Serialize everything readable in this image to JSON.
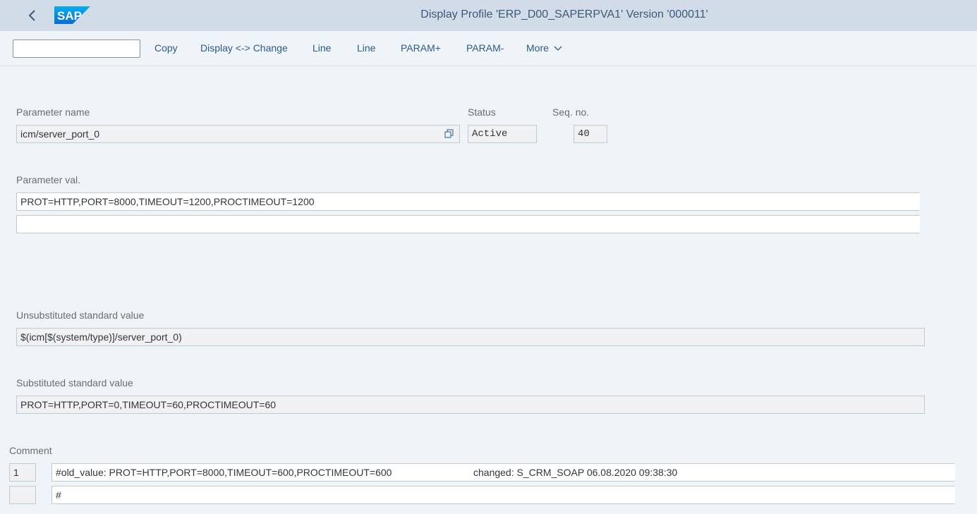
{
  "shell": {
    "logo_text": "SAP",
    "title": "Display Profile 'ERP_D00_SAPERPVA1' Version '000011'"
  },
  "toolbar": {
    "command_field_value": "",
    "buttons": [
      "Copy",
      "Display <-> Change",
      "Line",
      "Line",
      "PARAM+",
      "PARAM-",
      "More"
    ]
  },
  "form": {
    "param_name_label": "Parameter name",
    "param_name_value": "icm/server_port_0",
    "status_label": "Status",
    "status_value": "Active",
    "seq_label": "Seq. no.",
    "seq_value": "40",
    "param_val_label": "Parameter val.",
    "param_val_line1": "PROT=HTTP,PORT=8000,TIMEOUT=1200,PROCTIMEOUT=1200",
    "param_val_line2": "",
    "unsub_label": "Unsubstituted standard value",
    "unsub_value": "$(icm[$(system/type)]/server_port_0)",
    "sub_label": "Substituted standard value",
    "sub_value": "PROT=HTTP,PORT=0,TIMEOUT=60,PROCTIMEOUT=60"
  },
  "comment": {
    "label": "Comment",
    "rows": [
      {
        "num": "1",
        "text": "#old_value: PROT=HTTP,PORT=8000,TIMEOUT=600,PROCTIMEOUT=600",
        "changed": "changed: S_CRM_SOAP 06.08.2020 09:38:30"
      },
      {
        "num": "",
        "text": "#",
        "changed": ""
      }
    ]
  },
  "icons": {
    "back": "chevron-left-icon",
    "value_help": "value-help-icon",
    "more": "chevron-down-icon"
  },
  "colors": {
    "shellbar": "#d1dce8",
    "background": "#eff4f9",
    "link": "#2c5a8a",
    "sap_blue": "#0a6ed1"
  }
}
